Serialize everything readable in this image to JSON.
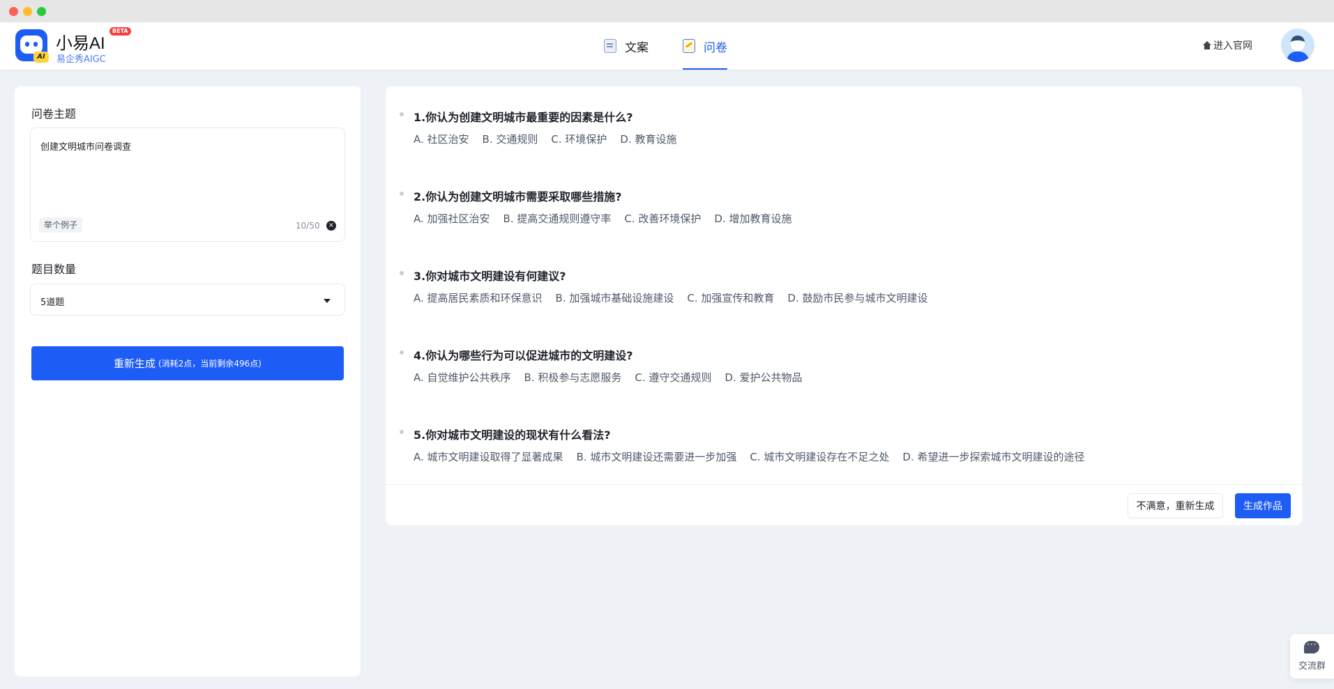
{
  "header": {
    "brand_name": "小易AI",
    "beta_badge": "BETA",
    "brand_sub": "易企秀AIGC",
    "logo_tag": "AI",
    "tabs": [
      {
        "label": "文案",
        "active": false
      },
      {
        "label": "问卷",
        "active": true
      }
    ],
    "home_link": "进入官网"
  },
  "left": {
    "topic_label": "问卷主题",
    "topic_value": "创建文明城市问卷调查",
    "example_tag": "举个例子",
    "char_count": "10/50",
    "count_label": "题目数量",
    "count_value": "5道题",
    "regen_main": "重新生成",
    "regen_sub": "(消耗2点，当前剩余496点)"
  },
  "questions": [
    {
      "title": "1.你认为创建文明城市最重要的因素是什么?",
      "options": [
        "A. 社区治安",
        "B. 交通规则",
        "C. 环境保护",
        "D. 教育设施"
      ]
    },
    {
      "title": "2.你认为创建文明城市需要采取哪些措施?",
      "options": [
        "A. 加强社区治安",
        "B. 提高交通规则遵守率",
        "C. 改善环境保护",
        "D. 增加教育设施"
      ]
    },
    {
      "title": "3.你对城市文明建设有何建议?",
      "options": [
        "A. 提高居民素质和环保意识",
        "B. 加强城市基础设施建设",
        "C. 加强宣传和教育",
        "D. 鼓励市民参与城市文明建设"
      ]
    },
    {
      "title": "4.你认为哪些行为可以促进城市的文明建设?",
      "options": [
        "A. 自觉维护公共秩序",
        "B. 积极参与志愿服务",
        "C. 遵守交通规则",
        "D. 爱护公共物品"
      ]
    },
    {
      "title": "5.你对城市文明建设的现状有什么看法?",
      "options": [
        "A. 城市文明建设取得了显著成果",
        "B. 城市文明建设还需要进一步加强",
        "C. 城市文明建设存在不足之处",
        "D. 希望进一步探索城市文明建设的途径"
      ]
    }
  ],
  "actions": {
    "retry": "不满意，重新生成",
    "produce": "生成作品"
  },
  "widget": {
    "label": "交流群"
  },
  "colors": {
    "accent": "#1d5cf5",
    "background": "#eef1f5",
    "beta": "#f53f3f"
  },
  "icons": [
    "home-icon",
    "chat-icon",
    "clear-icon",
    "caret-down-icon",
    "document-icon",
    "questionnaire-icon"
  ]
}
